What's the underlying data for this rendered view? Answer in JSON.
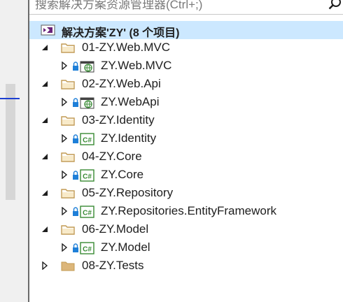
{
  "search": {
    "placeholder": "搜索解决方案资源管理器(Ctrl+;)"
  },
  "solution": {
    "label": "解决方案'ZY' (8 个项目)"
  },
  "folders": [
    {
      "label": "01-ZY.Web.MVC",
      "expanded": true,
      "project": {
        "label": "ZY.Web.MVC",
        "icon": "web-project-icon"
      }
    },
    {
      "label": "02-ZY.Web.Api",
      "expanded": true,
      "project": {
        "label": "ZY.WebApi",
        "icon": "web-project-icon"
      }
    },
    {
      "label": "03-ZY.Identity",
      "expanded": true,
      "project": {
        "label": "ZY.Identity",
        "icon": "csharp-project-icon"
      }
    },
    {
      "label": "04-ZY.Core",
      "expanded": true,
      "project": {
        "label": "ZY.Core",
        "icon": "csharp-project-icon"
      }
    },
    {
      "label": "05-ZY.Repository",
      "expanded": true,
      "project": {
        "label": "ZY.Repositories.EntityFramework",
        "icon": "csharp-project-icon"
      }
    },
    {
      "label": "06-ZY.Model",
      "expanded": true,
      "project": {
        "label": "ZY.Model",
        "icon": "csharp-project-icon"
      }
    },
    {
      "label": "08-ZY.Tests",
      "expanded": false
    }
  ],
  "colors": {
    "selection": "#cce8ff",
    "vs_purple": "#68217a",
    "folder": "#dcb67a",
    "lock": "#1e7fd8",
    "csharp_green": "#388a34"
  }
}
